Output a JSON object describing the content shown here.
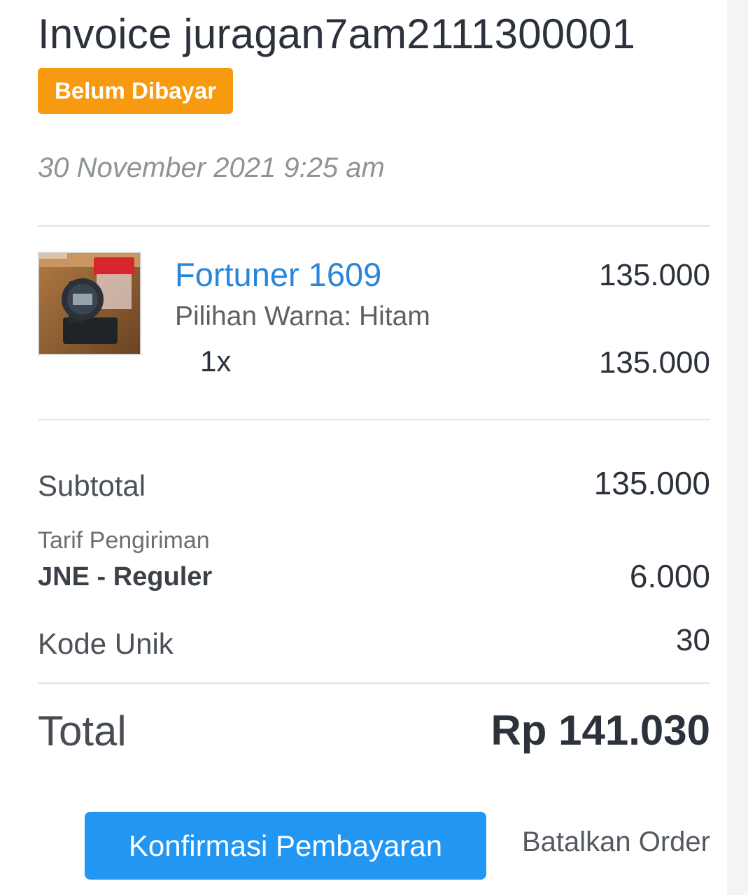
{
  "invoice": {
    "title": "Invoice juragan7am2111300001",
    "status_badge": "Belum Dibayar",
    "date": "30 November 2021 9:25 am"
  },
  "item": {
    "name": "Fortuner 1609",
    "variant": "Pilihan Warna: Hitam",
    "quantity": "1x",
    "unit_price": "135.000",
    "line_total": "135.000"
  },
  "summary": {
    "subtotal_label": "Subtotal",
    "subtotal_value": "135.000",
    "shipping_label": "Tarif Pengiriman",
    "shipping_service": "JNE - Reguler",
    "shipping_value": "6.000",
    "unique_code_label": "Kode Unik",
    "unique_code_value": "30",
    "total_label": "Total",
    "total_value": "Rp 141.030"
  },
  "actions": {
    "confirm_label": "Konfirmasi Pembayaran",
    "cancel_label": "Batalkan Order"
  },
  "colors": {
    "badge": "#f79a10",
    "link": "#2a86d9",
    "primary_button": "#2196f3",
    "text_dark": "#2b323b"
  }
}
